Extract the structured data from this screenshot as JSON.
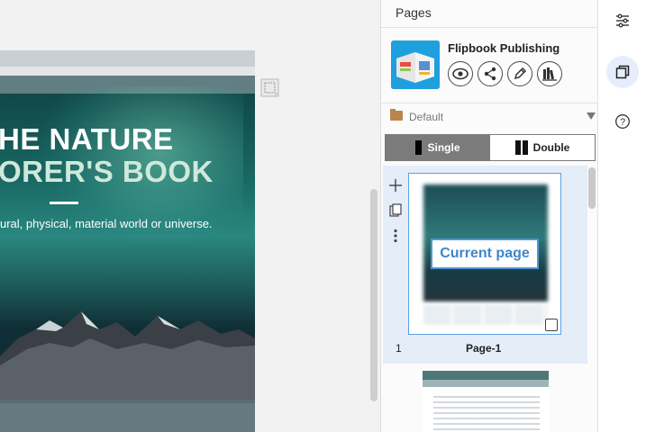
{
  "canvas": {
    "cover_title_line1": "HE NATURE",
    "cover_title_line2": "ORER'S BOOK",
    "cover_subtitle": "ural, physical, material world or universe."
  },
  "panel": {
    "title": "Pages",
    "publication": {
      "name": "Flipbook Publishing",
      "actions": [
        "eye-icon",
        "share-icon",
        "pencil-icon",
        "library-icon"
      ]
    },
    "group": {
      "label": "Default"
    },
    "view_mode": {
      "options": [
        "Single",
        "Double"
      ],
      "selected": "Single"
    },
    "pages": [
      {
        "number": "1",
        "label": "Page-1",
        "badge": "Current page",
        "selected": true
      }
    ]
  },
  "rail": {
    "icons": [
      "sliders-icon",
      "pages-icon",
      "help-icon"
    ],
    "active": "pages-icon"
  },
  "colors": {
    "accent": "#4f95d4",
    "segment_active": "#7b7b7b",
    "selection_bg": "#e4edf8"
  }
}
